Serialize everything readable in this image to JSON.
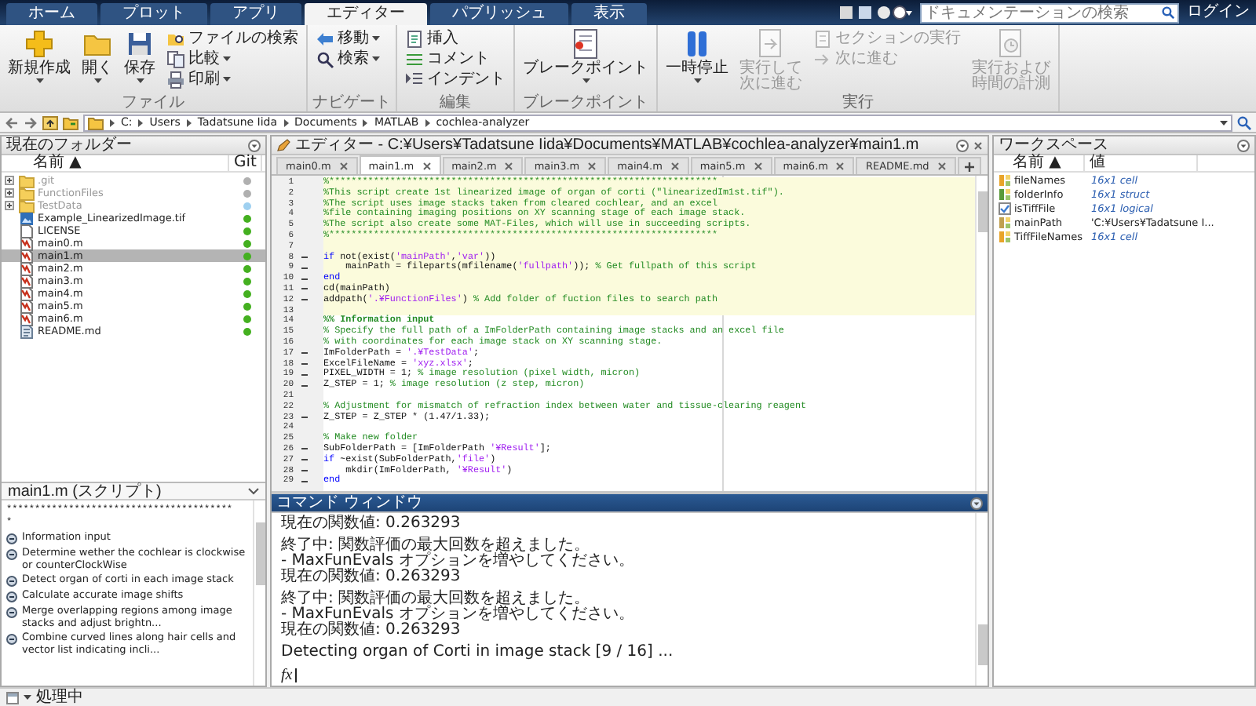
{
  "app_tabs": [
    {
      "label": "ホーム",
      "selected": false
    },
    {
      "label": "プロット",
      "selected": false
    },
    {
      "label": "アプリ",
      "selected": false
    },
    {
      "label": "エディター",
      "selected": true
    },
    {
      "label": "パブリッシュ",
      "selected": false
    },
    {
      "label": "表示",
      "selected": false
    }
  ],
  "doc_search": {
    "placeholder": "ドキュメンテーションの検索"
  },
  "login": "ログイン",
  "ribbon": {
    "groups": [
      {
        "label": "ファイル",
        "items": [
          {
            "label": "新規作成",
            "kind": "large",
            "dropdown": true,
            "disabled": false
          },
          {
            "label": "開く",
            "kind": "large",
            "dropdown": true,
            "disabled": false
          },
          {
            "label": "保存",
            "kind": "large",
            "dropdown": true,
            "disabled": false
          },
          {
            "label": "ファイルの検索",
            "kind": "small",
            "dropdown": false,
            "disabled": false
          },
          {
            "label": "比較",
            "kind": "small",
            "dropdown": true,
            "disabled": false
          },
          {
            "label": "印刷",
            "kind": "small",
            "dropdown": true,
            "disabled": false
          }
        ]
      },
      {
        "label": "ナビゲート",
        "items": [
          {
            "label": "移動",
            "kind": "small",
            "dropdown": true,
            "disabled": false
          },
          {
            "label": "検索",
            "kind": "small",
            "dropdown": true,
            "disabled": false
          }
        ]
      },
      {
        "label": "編集",
        "items": [
          {
            "label": "挿入",
            "kind": "small",
            "dropdown": false,
            "disabled": false
          },
          {
            "label": "コメント",
            "kind": "small",
            "dropdown": false,
            "disabled": false
          },
          {
            "label": "インデント",
            "kind": "small",
            "dropdown": false,
            "disabled": false
          }
        ]
      },
      {
        "label": "ブレークポイント",
        "items": [
          {
            "label": "ブレークポイント",
            "kind": "large",
            "dropdown": true,
            "disabled": false
          }
        ]
      },
      {
        "label": "実行",
        "items": [
          {
            "label": "一時停止",
            "kind": "large",
            "dropdown": true,
            "disabled": false
          },
          {
            "label": "実行して次に進む",
            "kind": "large_wrap",
            "dropdown": false,
            "disabled": true
          },
          {
            "label": "セクションの実行",
            "kind": "small",
            "dropdown": false,
            "disabled": true
          },
          {
            "label": "次に進む",
            "kind": "small",
            "dropdown": false,
            "disabled": true
          },
          {
            "label": "実行および時間の計測",
            "kind": "large_wrap",
            "dropdown": false,
            "disabled": true
          }
        ]
      }
    ]
  },
  "address": [
    "C:",
    "Users",
    "Tadatsune Iida",
    "Documents",
    "MATLAB",
    "cochlea-analyzer"
  ],
  "current_folder": {
    "title": "現在のフォルダー",
    "active": false,
    "columns": [
      {
        "label": "名前 ▲"
      },
      {
        "label": "Git"
      }
    ],
    "files": [
      {
        "name": ".git",
        "kind": "folder",
        "expanded": false,
        "color": "#b0b0b0",
        "selected": false
      },
      {
        "name": "FunctionFiles",
        "kind": "folder",
        "expanded": false,
        "color": "#b0b0b0",
        "selected": false
      },
      {
        "name": "TestData",
        "kind": "folder",
        "expanded": false,
        "color": "#9fd0f0",
        "selected": false
      },
      {
        "name": "Example_LinearizedImage.tif",
        "kind": "image",
        "color": "#44b020",
        "selected": false
      },
      {
        "name": "LICENSE",
        "kind": "text",
        "color": "#44b020",
        "selected": false
      },
      {
        "name": "main0.m",
        "kind": "script",
        "color": "#44b020",
        "selected": false
      },
      {
        "name": "main1.m",
        "kind": "script",
        "color": "#44b020",
        "selected": true
      },
      {
        "name": "main2.m",
        "kind": "script",
        "color": "#44b020",
        "selected": false
      },
      {
        "name": "main3.m",
        "kind": "script",
        "color": "#44b020",
        "selected": false
      },
      {
        "name": "main4.m",
        "kind": "script",
        "color": "#44b020",
        "selected": false
      },
      {
        "name": "main5.m",
        "kind": "script",
        "color": "#44b020",
        "selected": false
      },
      {
        "name": "main6.m",
        "kind": "script",
        "color": "#44b020",
        "selected": false
      },
      {
        "name": "README.md",
        "kind": "markdown",
        "color": "#44b020",
        "selected": false
      }
    ]
  },
  "details": {
    "title": "main1.m (スクリプト)",
    "lines": [
      "****************************************",
      "*"
    ],
    "sections": [
      "Information input",
      "Determine wether the cochlear is clockwise or counterClockWise",
      "Detect organ of corti in each image stack",
      "Calculate accurate image shifts",
      "Merge overlapping regions among image stacks and adjust brightn...",
      "Combine curved lines along hair cells and vector list indicating incli..."
    ]
  },
  "editor": {
    "title": "エディター - C:¥Users¥Tadatsune Iida¥Documents¥MATLAB¥cochlea-analyzer¥main1.m",
    "active": false,
    "tabs": [
      {
        "label": "main0.m",
        "selected": false
      },
      {
        "label": "main1.m",
        "selected": true
      },
      {
        "label": "main2.m",
        "selected": false
      },
      {
        "label": "main3.m",
        "selected": false
      },
      {
        "label": "main4.m",
        "selected": false
      },
      {
        "label": "main5.m",
        "selected": false
      },
      {
        "label": "main6.m",
        "selected": false
      },
      {
        "label": "README.md",
        "selected": false
      }
    ],
    "lines": [
      {
        "number": "1",
        "executable": false,
        "highlighted": true,
        "segments": [
          {
            "kind": "comment",
            "text": "%**********************************************************************"
          }
        ]
      },
      {
        "number": "2",
        "executable": false,
        "highlighted": true,
        "segments": [
          {
            "kind": "comment",
            "text": "%This script create 1st linearized image of organ of corti (\"linearizedIm1st.tif\")."
          }
        ]
      },
      {
        "number": "3",
        "executable": false,
        "highlighted": true,
        "segments": [
          {
            "kind": "comment",
            "text": "%The script uses image stacks taken from cleared cochlear, and an excel"
          }
        ]
      },
      {
        "number": "4",
        "executable": false,
        "highlighted": true,
        "segments": [
          {
            "kind": "comment",
            "text": "%file containing imaging positions on XY scanning stage of each image stack."
          }
        ]
      },
      {
        "number": "5",
        "executable": false,
        "highlighted": true,
        "segments": [
          {
            "kind": "comment",
            "text": "%The script also create some MAT-Files, which will use in succeeding scripts."
          }
        ]
      },
      {
        "number": "6",
        "executable": false,
        "highlighted": true,
        "segments": [
          {
            "kind": "comment",
            "text": "%**********************************************************************"
          }
        ]
      },
      {
        "number": "7",
        "executable": false,
        "highlighted": true
      },
      {
        "number": "8",
        "executable": true,
        "highlighted": true,
        "segments": [
          {
            "kind": "keyword",
            "text": "if"
          },
          {
            "kind": "code",
            "text": " not(exist("
          },
          {
            "kind": "string",
            "text": "'mainPath'"
          },
          {
            "kind": "code",
            "text": ","
          },
          {
            "kind": "string",
            "text": "'var'"
          },
          {
            "kind": "code",
            "text": "))"
          }
        ]
      },
      {
        "number": "9",
        "executable": true,
        "highlighted": true,
        "segments": [
          {
            "kind": "code",
            "text": "    mainPath = fileparts(mfilename("
          },
          {
            "kind": "string",
            "text": "'fullpath'"
          },
          {
            "kind": "code",
            "text": ")); "
          },
          {
            "kind": "comment",
            "text": "% Get fullpath of this script"
          }
        ]
      },
      {
        "number": "10",
        "executable": true,
        "highlighted": true,
        "segments": [
          {
            "kind": "keyword",
            "text": "end"
          }
        ]
      },
      {
        "number": "11",
        "executable": true,
        "highlighted": true,
        "segments": [
          {
            "kind": "code",
            "text": "cd(mainPath)"
          }
        ]
      },
      {
        "number": "12",
        "executable": true,
        "highlighted": true,
        "segments": [
          {
            "kind": "code",
            "text": "addpath("
          },
          {
            "kind": "string",
            "text": "'.¥FunctionFiles'"
          },
          {
            "kind": "code",
            "text": ") "
          },
          {
            "kind": "comment",
            "text": "% Add folder of fuction files to search path"
          }
        ]
      },
      {
        "number": "13",
        "executable": false,
        "highlighted": true
      },
      {
        "number": "14",
        "executable": false,
        "highlighted": false,
        "segments": [
          {
            "kind": "section",
            "text": "%% Information input"
          }
        ]
      },
      {
        "number": "15",
        "executable": false,
        "highlighted": false,
        "segments": [
          {
            "kind": "comment",
            "text": "% Specify the full path of a ImFolderPath containing image stacks and an excel file"
          }
        ]
      },
      {
        "number": "16",
        "executable": false,
        "highlighted": false,
        "segments": [
          {
            "kind": "comment",
            "text": "% with coordinates for each image stack on XY scanning stage."
          }
        ]
      },
      {
        "number": "17",
        "executable": true,
        "highlighted": false,
        "segments": [
          {
            "kind": "code",
            "text": "ImFolderPath = "
          },
          {
            "kind": "string",
            "text": "'.¥TestData'"
          },
          {
            "kind": "code",
            "text": ";"
          }
        ]
      },
      {
        "number": "18",
        "executable": true,
        "highlighted": false,
        "segments": [
          {
            "kind": "code",
            "text": "ExcelFileName = "
          },
          {
            "kind": "string",
            "text": "'xyz.xlsx'"
          },
          {
            "kind": "code",
            "text": ";"
          }
        ]
      },
      {
        "number": "19",
        "executable": true,
        "highlighted": false,
        "segments": [
          {
            "kind": "code",
            "text": "PIXEL_WIDTH = 1; "
          },
          {
            "kind": "comment",
            "text": "% image resolution (pixel width, micron)"
          }
        ]
      },
      {
        "number": "20",
        "executable": true,
        "highlighted": false,
        "segments": [
          {
            "kind": "code",
            "text": "Z_STEP = 1; "
          },
          {
            "kind": "comment",
            "text": "% image resolution (z step, micron)"
          }
        ]
      },
      {
        "number": "21",
        "executable": false,
        "highlighted": false
      },
      {
        "number": "22",
        "executable": false,
        "highlighted": false,
        "segments": [
          {
            "kind": "comment",
            "text": "% Adjustment for mismatch of refraction index between water and tissue-clearing reagent"
          }
        ]
      },
      {
        "number": "23",
        "executable": true,
        "highlighted": false,
        "segments": [
          {
            "kind": "code",
            "text": "Z_STEP = Z_STEP * (1.47/1.33);"
          }
        ]
      },
      {
        "number": "24",
        "executable": false,
        "highlighted": false
      },
      {
        "number": "25",
        "executable": false,
        "highlighted": false,
        "segments": [
          {
            "kind": "comment",
            "text": "% Make new folder"
          }
        ]
      },
      {
        "number": "26",
        "executable": true,
        "highlighted": false,
        "segments": [
          {
            "kind": "code",
            "text": "SubFolderPath = [ImFolderPath "
          },
          {
            "kind": "string",
            "text": "'¥Result'"
          },
          {
            "kind": "code",
            "text": "];"
          }
        ]
      },
      {
        "number": "27",
        "executable": true,
        "highlighted": false,
        "segments": [
          {
            "kind": "keyword",
            "text": "if"
          },
          {
            "kind": "code",
            "text": " ~exist(SubFolderPath,"
          },
          {
            "kind": "string",
            "text": "'file'"
          },
          {
            "kind": "code",
            "text": ")"
          }
        ]
      },
      {
        "number": "28",
        "executable": true,
        "highlighted": false,
        "segments": [
          {
            "kind": "code",
            "text": "    mkdir(ImFolderPath, "
          },
          {
            "kind": "string",
            "text": "'¥Result'"
          },
          {
            "kind": "code",
            "text": ")"
          }
        ]
      },
      {
        "number": "29",
        "executable": true,
        "highlighted": false,
        "segments": [
          {
            "kind": "keyword",
            "text": "end"
          }
        ]
      }
    ]
  },
  "command_window": {
    "title": "コマンド ウィンドウ",
    "active": true,
    "blocks": [
      [
        "現在の関数値: 0.263293"
      ],
      [
        "終了中: 関数評価の最大回数を超えました。",
        "- MaxFunEvals オプションを増やしてください。",
        "現在の関数値: 0.263293"
      ],
      [
        "終了中: 関数評価の最大回数を超えました。",
        "- MaxFunEvals オプションを増やしてください。",
        "現在の関数値: 0.263293"
      ],
      [
        "Detecting organ of Corti in image stack [9 / 16] ..."
      ]
    ],
    "prompt": "fx"
  },
  "workspace": {
    "title": "ワークスペース",
    "active": false,
    "columns": [
      {
        "label": "名前 ▲"
      },
      {
        "label": "値"
      }
    ],
    "variables": [
      {
        "name": "fileNames",
        "value": "16x1 cell",
        "kind": "cell"
      },
      {
        "name": "folderInfo",
        "value": "16x1 struct",
        "kind": "struct"
      },
      {
        "name": "isTiffFile",
        "value": "16x1 logical",
        "kind": "logical"
      },
      {
        "name": "mainPath",
        "value": "'C:¥Users¥Tadatsune I...",
        "kind": "char"
      },
      {
        "name": "TiffFileNames",
        "value": "16x1 cell",
        "kind": "cell"
      }
    ]
  },
  "status_bar": {
    "text": "処理中"
  }
}
